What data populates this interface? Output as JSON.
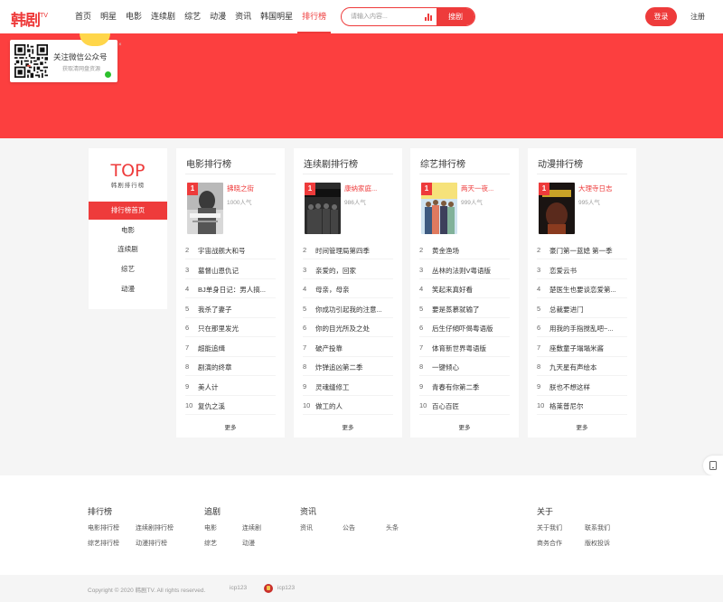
{
  "header": {
    "logo": "韩剧",
    "logo_tv": "TV",
    "nav": [
      "首页",
      "明星",
      "电影",
      "连续剧",
      "综艺",
      "动漫",
      "资讯",
      "韩国明星",
      "排行榜"
    ],
    "active_nav": "排行榜",
    "search_placeholder": "请输入内容...",
    "search_button": "搜剧",
    "login": "登录",
    "register": "注册",
    "accent_color": "#ee3b3b"
  },
  "qr_popup": {
    "title": "关注微信公众号",
    "subtitle": "获取清网盘资源",
    "close": "×"
  },
  "side": {
    "top": "TOP",
    "subtitle": "韩剧排行榜",
    "items": [
      "排行榜首页",
      "电影",
      "连续剧",
      "综艺",
      "动漫"
    ],
    "active": "排行榜首页"
  },
  "cards": [
    {
      "title": "电影排行榜",
      "top": {
        "rank": "1",
        "name": "拂晓之街",
        "popularity": "1000人气",
        "poster_text": "夜明けの街で"
      },
      "rows": [
        {
          "rank": "2",
          "name": "宇宙战舰大和号"
        },
        {
          "rank": "3",
          "name": "墓督山恩仇记"
        },
        {
          "rank": "4",
          "name": "BJ单身日记：男人搞..."
        },
        {
          "rank": "5",
          "name": "我杀了妻子"
        },
        {
          "rank": "6",
          "name": "只在那里发光"
        },
        {
          "rank": "7",
          "name": "超能追缉"
        },
        {
          "rank": "8",
          "name": "剧演的终章"
        },
        {
          "rank": "9",
          "name": "美人计"
        },
        {
          "rank": "10",
          "name": "复仇之溪"
        }
      ],
      "more": "更多"
    },
    {
      "title": "连续剧排行榜",
      "top": {
        "rank": "1",
        "name": "康纳家庭...",
        "popularity": "986人气",
        "poster_text": "NNERS"
      },
      "rows": [
        {
          "rank": "2",
          "name": "时间管理局第四季"
        },
        {
          "rank": "3",
          "name": "亲爱的，回家"
        },
        {
          "rank": "4",
          "name": "母亲，母亲"
        },
        {
          "rank": "5",
          "name": "你成功引起我的注意..."
        },
        {
          "rank": "6",
          "name": "你的目光所及之处"
        },
        {
          "rank": "7",
          "name": "破产投靠"
        },
        {
          "rank": "8",
          "name": "炸弹追凶第二季"
        },
        {
          "rank": "9",
          "name": "灵魂缝修工"
        },
        {
          "rank": "10",
          "name": "做工的人"
        }
      ],
      "more": "更多"
    },
    {
      "title": "综艺排行榜",
      "top": {
        "rank": "1",
        "name": "两天一夜...",
        "popularity": "999人气",
        "poster_text": ""
      },
      "rows": [
        {
          "rank": "2",
          "name": "黄金渔场"
        },
        {
          "rank": "3",
          "name": "丛林的法则V粤语版"
        },
        {
          "rank": "4",
          "name": "笑起来真好看"
        },
        {
          "rank": "5",
          "name": "要是蒸慕就输了"
        },
        {
          "rank": "6",
          "name": "后生仔傾吓偈粤语版"
        },
        {
          "rank": "7",
          "name": "体育新世界粤语版"
        },
        {
          "rank": "8",
          "name": "一键倾心"
        },
        {
          "rank": "9",
          "name": "青春有你第二季"
        },
        {
          "rank": "10",
          "name": "百心百匠"
        }
      ],
      "more": "更多"
    },
    {
      "title": "动漫排行榜",
      "top": {
        "rank": "1",
        "name": "大理寺日志",
        "popularity": "995人气",
        "poster_text": "大理寺日志"
      },
      "rows": [
        {
          "rank": "2",
          "name": "豪门第一蓝媳 第一季"
        },
        {
          "rank": "3",
          "name": "恋爱云书"
        },
        {
          "rank": "4",
          "name": "楚医生也要谈恋爱第..."
        },
        {
          "rank": "5",
          "name": "总裁要进门"
        },
        {
          "rank": "6",
          "name": "用我的手指搅乱吧~..."
        },
        {
          "rank": "7",
          "name": "座敷童子塌塌米酱"
        },
        {
          "rank": "8",
          "name": "九天星有声绘本"
        },
        {
          "rank": "9",
          "name": "朕也不想这样"
        },
        {
          "rank": "10",
          "name": "格莱普尼尔"
        }
      ],
      "more": "更多"
    }
  ],
  "footer": {
    "sections": [
      {
        "title": "排行榜",
        "links": [
          "电影排行榜",
          "连续剧排行榜",
          "综艺排行榜",
          "动漫排行榜"
        ]
      },
      {
        "title": "追剧",
        "links": [
          "电影",
          "连续剧",
          "综艺",
          "动漫"
        ]
      },
      {
        "title": "资讯",
        "links": [
          "资讯",
          "公告",
          "头条"
        ]
      },
      {
        "title": "关于",
        "links": [
          "关于我们",
          "联系我们",
          "商务合作",
          "版权投诉"
        ]
      }
    ],
    "copyright": "Copyright © 2020 韩剧TV. All rights reserved.",
    "icp1": "icp123",
    "icp2": "icp123"
  }
}
